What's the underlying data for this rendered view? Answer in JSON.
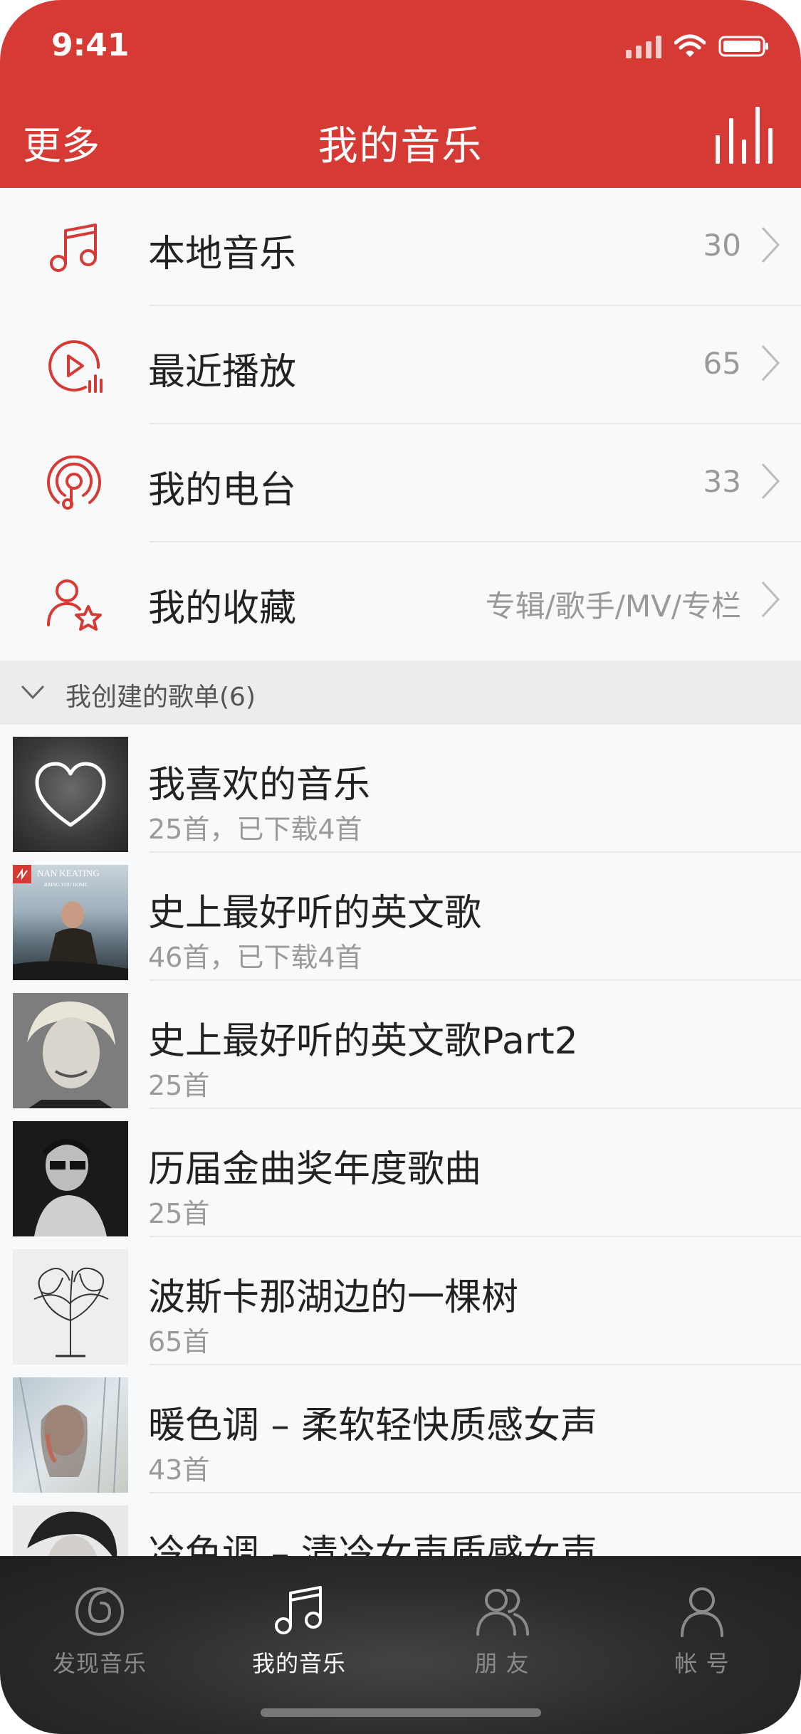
{
  "status_bar": {
    "time": "9:41"
  },
  "header": {
    "left_label": "更多",
    "title": "我的音乐",
    "background": "#d63a34"
  },
  "menu": [
    {
      "label": "本地音乐",
      "value": "30",
      "icon": "music-note-icon"
    },
    {
      "label": "最近播放",
      "value": "65",
      "icon": "recent-play-icon"
    },
    {
      "label": "我的电台",
      "value": "33",
      "icon": "radio-icon"
    },
    {
      "label": "我的收藏",
      "value": "专辑/歌手/MV/专栏",
      "icon": "user-star-icon"
    }
  ],
  "section": {
    "label": "我创建的歌单(6)"
  },
  "playlists": [
    {
      "title": "我喜欢的音乐",
      "subtitle": "25首，已下载4首"
    },
    {
      "title": "史上最好听的英文歌",
      "subtitle": "46首，已下载4首"
    },
    {
      "title": "史上最好听的英文歌Part2",
      "subtitle": "25首"
    },
    {
      "title": "历届金曲奖年度歌曲",
      "subtitle": "25首"
    },
    {
      "title": "波斯卡那湖边的一棵树",
      "subtitle": "65首"
    },
    {
      "title": "暖色调 – 柔软轻快质感女声",
      "subtitle": "43首"
    },
    {
      "title": "冷色调 – 清冷女声质感女声",
      "subtitle": ""
    }
  ],
  "covers": {
    "cover2_text": "NAN KEATING",
    "cover2_subtext": "BRING YOU HOME"
  },
  "tabbar": [
    {
      "label": "发现音乐",
      "icon": "discover-icon",
      "active": false
    },
    {
      "label": "我的音乐",
      "icon": "music-note-icon",
      "active": true
    },
    {
      "label": "朋 友",
      "icon": "friends-icon",
      "active": false
    },
    {
      "label": "帐 号",
      "icon": "account-icon",
      "active": false
    }
  ],
  "colors": {
    "accent": "#d63a34",
    "tab_active": "#ffffff",
    "tab_inactive": "#8a8a8a"
  }
}
